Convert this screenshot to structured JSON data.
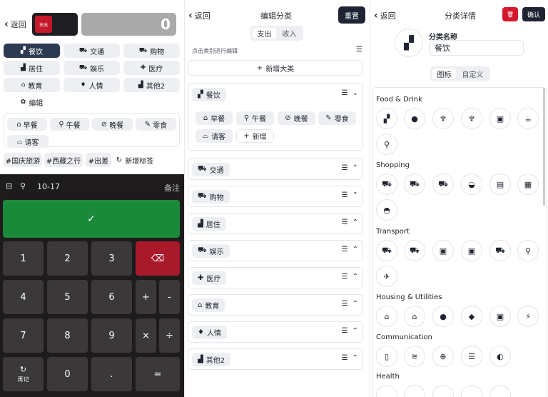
{
  "p1": {
    "back": "返回",
    "type_label": "支出",
    "amount": "0",
    "categories": [
      {
        "icon": "▞",
        "label": "餐饮"
      },
      {
        "icon": "⛟",
        "label": "交通"
      },
      {
        "icon": "⛟",
        "label": "购物"
      },
      {
        "icon": "▟",
        "label": "居住"
      },
      {
        "icon": "⛟",
        "label": "娱乐"
      },
      {
        "icon": "✚",
        "label": "医疗"
      },
      {
        "icon": "⌂",
        "label": "教育"
      },
      {
        "icon": "♦",
        "label": "人情"
      },
      {
        "icon": "▟",
        "label": "其他2"
      },
      {
        "icon": "✿",
        "label": "编辑"
      }
    ],
    "subs": [
      {
        "icon": "⌂",
        "label": "早餐"
      },
      {
        "icon": "⚲",
        "label": "午餐"
      },
      {
        "icon": "⊘",
        "label": "晚餐"
      },
      {
        "icon": "✎",
        "label": "零食"
      },
      {
        "icon": "⌓",
        "label": "请客"
      }
    ],
    "tags": [
      "#国庆旅游",
      "#西藏之行",
      "#出差"
    ],
    "add_tag": "新增标签",
    "date": "10-17",
    "note": "备注",
    "confirm": "✓",
    "keys": [
      "1",
      "2",
      "3",
      "⌫",
      "4",
      "5",
      "6",
      "+",
      "-",
      "7",
      "8",
      "9",
      "×",
      "÷",
      "再记",
      "0",
      ".",
      "="
    ]
  },
  "p2": {
    "back": "返回",
    "title": "编辑分类",
    "reset": "重置",
    "seg_on": "支出",
    "seg_off": "收入",
    "hint": "点击类别进行编辑",
    "add_big": "新增大类",
    "first": {
      "icon": "▞",
      "label": "餐饮"
    },
    "first_subs": [
      {
        "icon": "⌂",
        "label": "早餐"
      },
      {
        "icon": "⚲",
        "label": "午餐"
      },
      {
        "icon": "⊘",
        "label": "晚餐"
      },
      {
        "icon": "✎",
        "label": "零食"
      },
      {
        "icon": "⌓",
        "label": "请客"
      },
      {
        "icon": "+",
        "label": "新增"
      }
    ],
    "cats": [
      {
        "icon": "⛟",
        "label": "交通"
      },
      {
        "icon": "⛟",
        "label": "购物"
      },
      {
        "icon": "▟",
        "label": "居住"
      },
      {
        "icon": "⛟",
        "label": "娱乐"
      },
      {
        "icon": "✚",
        "label": "医疗"
      },
      {
        "icon": "⌂",
        "label": "教育"
      },
      {
        "icon": "♦",
        "label": "人情"
      },
      {
        "icon": "▟",
        "label": "其他2"
      }
    ]
  },
  "p3": {
    "back": "返回",
    "title": "分类详情",
    "delete": "🗑",
    "confirm": "确认",
    "big_icon": "▞",
    "name_label": "分类名称",
    "name_value": "餐饮",
    "seg_on": "图标",
    "seg_off": "自定义",
    "groups": [
      {
        "title": "Food & Drink",
        "icons": [
          "▞",
          "●",
          "♆",
          "♆",
          "▣",
          "☕",
          "⚲"
        ]
      },
      {
        "title": "Shopping",
        "icons": [
          "⛟",
          "⛟",
          "⛟",
          "◒",
          "▤",
          "▦",
          "◓"
        ]
      },
      {
        "title": "Transport",
        "icons": [
          "⛟",
          "⛟",
          "▣",
          "▣",
          "⛟",
          "⚲",
          "✈"
        ]
      },
      {
        "title": "Housing & Utilities",
        "icons": [
          "⌂",
          "⌂",
          "●",
          "◆",
          "▣",
          "⚡"
        ]
      },
      {
        "title": "Communication",
        "icons": [
          "▯",
          "≋",
          "⊕",
          "☰",
          "◐"
        ]
      },
      {
        "title": "Health",
        "icons": []
      }
    ]
  }
}
